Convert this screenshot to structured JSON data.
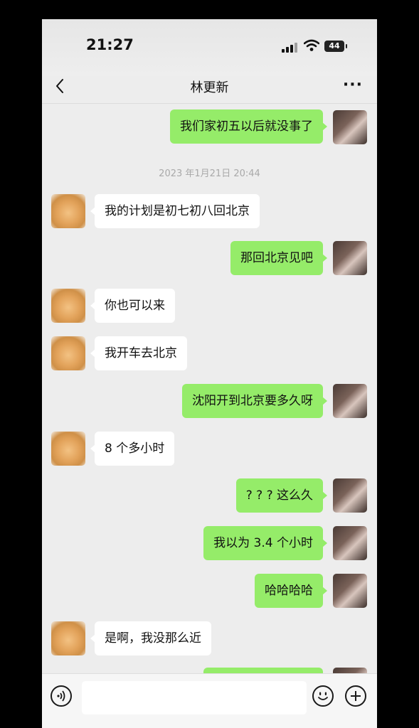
{
  "status_bar": {
    "time": "21:27",
    "battery": "44"
  },
  "nav": {
    "title": "林更新",
    "more": "···"
  },
  "timestamp": "2023 年1月21日 20:44",
  "messages": [
    {
      "side": "out",
      "text": "我们家初五以后就没事了"
    },
    {
      "side": "in",
      "text": "我的计划是初七初八回北京"
    },
    {
      "side": "out",
      "text": "那回北京见吧"
    },
    {
      "side": "in",
      "text": "你也可以来"
    },
    {
      "side": "in",
      "text": "我开车去北京"
    },
    {
      "side": "out",
      "text": "沈阳开到北京要多久呀"
    },
    {
      "side": "in",
      "text": "8 个多小时"
    },
    {
      "side": "out",
      "text": "? ? ?  这么久"
    },
    {
      "side": "out",
      "text": "我以为 3.4 个小时"
    },
    {
      "side": "out",
      "text": "哈哈哈哈"
    },
    {
      "side": "in",
      "text": "是啊，我没那么近"
    }
  ],
  "colors": {
    "outgoing_bubble": "#95ec69",
    "incoming_bubble": "#ffffff",
    "background": "#ededed"
  }
}
